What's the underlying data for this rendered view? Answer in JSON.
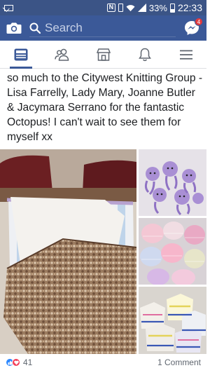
{
  "status_bar": {
    "battery_percent": "33%",
    "time": "22:33",
    "icons": [
      "mail-icon",
      "nfc-icon",
      "vibrate-icon",
      "wifi-icon",
      "signal-icon",
      "battery-icon"
    ]
  },
  "top_bar": {
    "search_placeholder": "Search",
    "messenger_badge": "4",
    "colors": {
      "bar": "#3b5998",
      "status": "#3b5486",
      "badge": "#e0393e"
    }
  },
  "nav": {
    "tabs": [
      {
        "icon": "news-feed-icon",
        "active": true
      },
      {
        "icon": "friends-icon",
        "active": false
      },
      {
        "icon": "marketplace-icon",
        "active": false
      },
      {
        "icon": "notifications-bell-icon",
        "active": false
      },
      {
        "icon": "menu-icon",
        "active": false
      }
    ]
  },
  "post": {
    "text": "so much to the Citywest Knitting Group - Lisa Farrelly, Lady Mary, Joanne Butler & Jacymara Serrano for the fantastic Octopus! I can't wait to see them for myself xx",
    "photos": [
      "knitted-blankets-photo",
      "purple-octopus-photo",
      "knitted-hats-photo",
      "knitted-cardigans-photo"
    ]
  },
  "reactions": {
    "count": "41",
    "comments": "1 Comment",
    "icons": [
      "like-reaction-icon",
      "love-reaction-icon"
    ]
  }
}
